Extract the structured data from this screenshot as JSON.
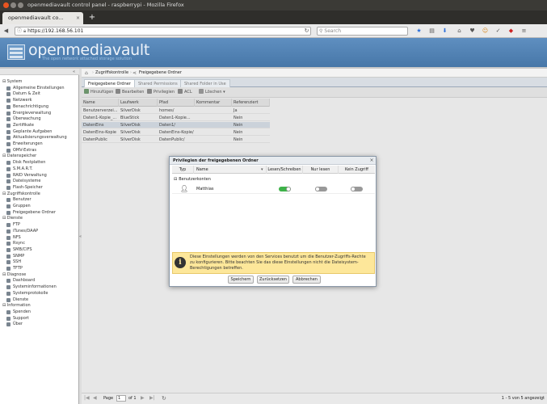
{
  "window": {
    "title": "openmediavault control panel - raspberrypi - Mozilla Firefox"
  },
  "browser": {
    "tab_title": "openmediavault co...",
    "tab_close": "×",
    "new_tab": "+",
    "url": "https://192.168.56.101",
    "search_placeholder": "Search"
  },
  "app": {
    "brand": "openmediavault",
    "tagline": "The open network attached storage solution"
  },
  "sidebar": {
    "collapse": "«",
    "groups": [
      {
        "label": "System",
        "items": [
          "Allgemeine Einstellungen",
          "Datum & Zeit",
          "Netzwerk",
          "Benachrichtigung",
          "Energieverwaltung",
          "Überwachung",
          "Zertifikate",
          "Geplante Aufgaben",
          "Aktualisierungsverwaltung",
          "Erweiterungen",
          "OMV-Extras"
        ]
      },
      {
        "label": "Datenspeicher",
        "items": [
          "Disk Festplatten",
          "S.M.A.R.T.",
          "RAID Verwaltung",
          "Dateisysteme",
          "Flash-Speicher"
        ]
      },
      {
        "label": "Zugriffskontrolle",
        "items": [
          "Benutzer",
          "Gruppen",
          "Freigegebene Ordner"
        ]
      },
      {
        "label": "Dienste",
        "items": [
          "FTP",
          "iTunes/DAAP",
          "NFS",
          "Rsync",
          "SMB/CIFS",
          "SNMP",
          "SSH",
          "TFTP"
        ]
      },
      {
        "label": "Diagnose",
        "items": [
          "Dashboard",
          "Systeminformationen",
          "Systemprotokolle",
          "Dienste"
        ]
      },
      {
        "label": "Information",
        "items": [
          "Spenden",
          "Support",
          "Über"
        ]
      }
    ]
  },
  "breadcrumb": {
    "part1": "Zugriffskontrolle",
    "part2": "Freigegebene Ordner"
  },
  "panel_tabs": [
    "Freigegebene Ordner",
    "Shared Permissions",
    "Shared Folder in Use"
  ],
  "toolbar": {
    "add": "Hinzufügen",
    "edit": "Bearbeiten",
    "privileges": "Privilegien",
    "acl": "ACL",
    "delete": "Löschen"
  },
  "grid": {
    "columns": [
      "Name",
      "Laufwerk",
      "Pfad",
      "Kommentar",
      "Referenziert"
    ],
    "rows": [
      [
        "Benutzerverzei...",
        "SilverDisk",
        "homes/",
        "",
        "Ja"
      ],
      [
        "Daten1-Kopie_...",
        "BlueStick",
        "Daten1-Kopie...",
        "",
        "Nein"
      ],
      [
        "DatenEins",
        "SilverDisk",
        "Daten1/",
        "",
        "Nein"
      ],
      [
        "DatenEins-Kopie",
        "SilverDisk",
        "DatenEins-Kopie/",
        "",
        "Nein"
      ],
      [
        "DatenPublic",
        "SilverDisk",
        "DatenPublic/",
        "",
        "Nein"
      ]
    ]
  },
  "pager": {
    "page_label": "Page",
    "page_value": "1",
    "of_label": "of 1",
    "status": "1 - 5 von 5 angezeigt"
  },
  "dialog": {
    "title": "Privilegien der freigegebenen Ordner",
    "close": "×",
    "columns": [
      "Typ",
      "Name",
      "Lesen/Schreiben",
      "Nur lesen",
      "Kein Zugriff"
    ],
    "group_label": "Benutzerkonten",
    "group_toggle": "⊟",
    "row": {
      "name": "Matthias",
      "read_write": true,
      "read_only": false,
      "no_access": false
    },
    "info_text": "Diese Einstellungen werden von den Services benutzt um die Benutzer-Zugriffs-Rechte zu konfigurieren. Bitte beachten Sie das diese Einstellungen nicht die Dateisystem-Berechtigungen betreffen.",
    "buttons": {
      "save": "Speichern",
      "reset": "Zurücksetzen",
      "cancel": "Abbrechen"
    }
  },
  "colors": {
    "header": "#4f7fb0",
    "toggle_on": "#3db249",
    "toggle_off": "#999999",
    "info_bg": "#fde79a"
  }
}
